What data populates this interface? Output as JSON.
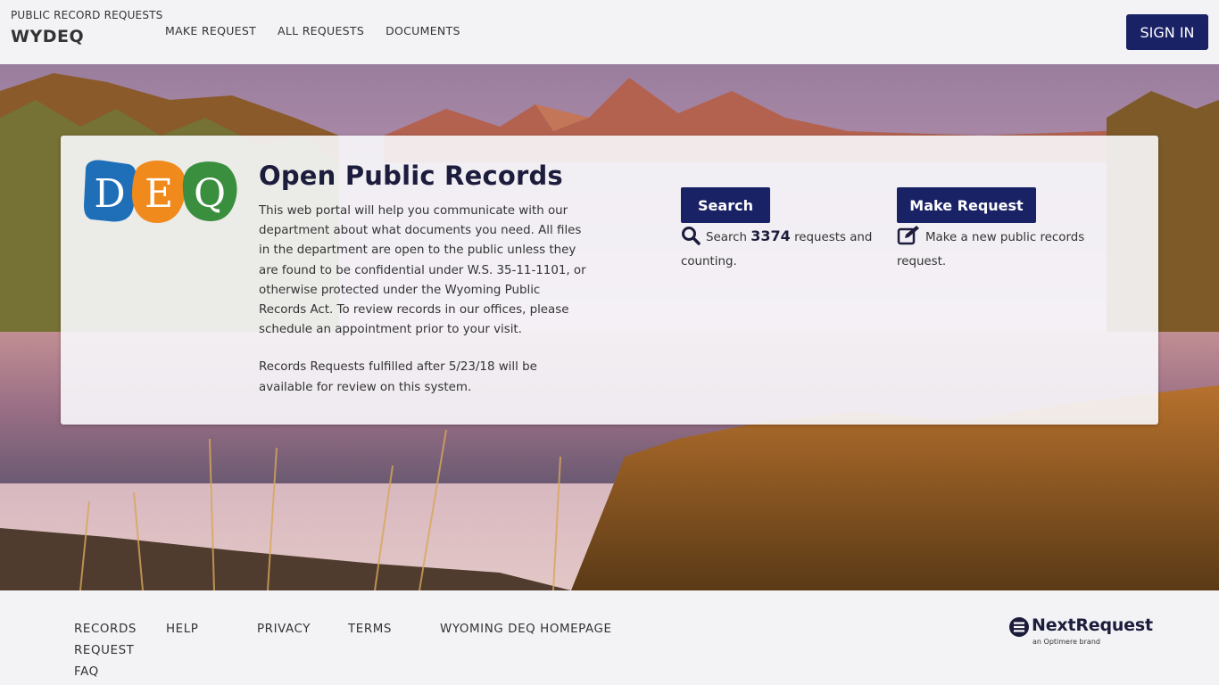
{
  "header": {
    "subtitle": "PUBLIC RECORD REQUESTS",
    "title": "WYDEQ",
    "nav": [
      "MAKE REQUEST",
      "ALL REQUESTS",
      "DOCUMENTS"
    ],
    "signin_label": "SIGN IN"
  },
  "hero": {
    "title": "Open Public Records",
    "description": "This web portal will help you communicate with our department about what documents you need. All files in the department are open to the public unless they are found to be confidential under W.S. 35-11-1101, or otherwise protected under the Wyoming Public Records Act. To review records in our offices, please schedule an appointment prior to your visit.",
    "note": "Records Requests fulfilled after 5/23/18 will be available for review on this system.",
    "logo_letters": [
      "D",
      "E",
      "Q"
    ]
  },
  "search": {
    "button_label": "Search",
    "prefix": "Search",
    "count": "3374",
    "suffix": "requests and counting.",
    "icon": "search-icon"
  },
  "make_request": {
    "button_label": "Make Request",
    "text": "Make a new public records request.",
    "icon": "edit-icon"
  },
  "footer": {
    "links": [
      "RECORDS REQUEST FAQ",
      "HELP",
      "PRIVACY",
      "TERMS",
      "WYOMING DEQ HOMEPAGE"
    ],
    "brand_name": "NextRequest",
    "brand_tagline": "an Optimere brand"
  },
  "colors": {
    "primary": "#1a2266",
    "background": "#f3f3f6",
    "logo_blue": "#1f6fb8",
    "logo_orange": "#f08a1c",
    "logo_green": "#3a8f3e"
  }
}
